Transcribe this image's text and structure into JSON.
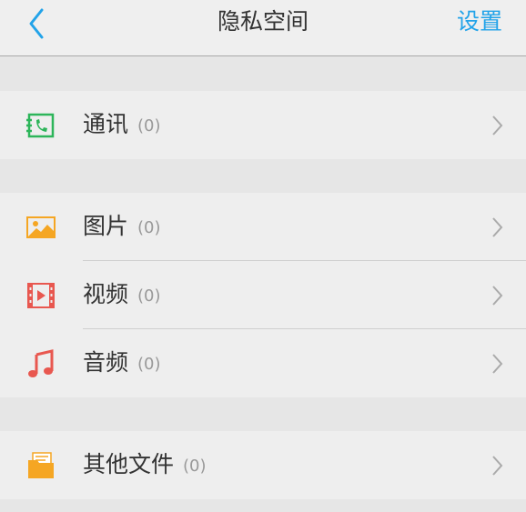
{
  "header": {
    "title": "隐私空间",
    "settings_label": "设置",
    "back_icon": "chevron-left-icon"
  },
  "colors": {
    "accent": "#22a3e9",
    "contacts_icon": "#2db55a",
    "photos_icon": "#f5a623",
    "video_icon": "#e8574f",
    "audio_icon": "#e8574f",
    "files_icon": "#f5a623"
  },
  "items": [
    {
      "label": "通讯",
      "count": "(0)",
      "icon": "phone-book-icon"
    },
    {
      "label": "图片",
      "count": "(0)",
      "icon": "image-icon"
    },
    {
      "label": "视频",
      "count": "(0)",
      "icon": "video-icon"
    },
    {
      "label": "音频",
      "count": "(0)",
      "icon": "music-note-icon"
    },
    {
      "label": "其他文件",
      "count": "(0)",
      "icon": "folder-icon"
    }
  ]
}
